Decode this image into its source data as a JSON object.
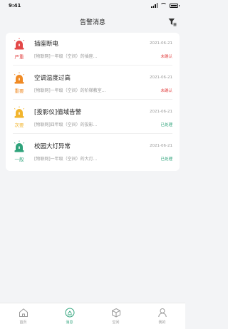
{
  "status_bar": {
    "time": "9:41"
  },
  "header": {
    "title": "告警消息"
  },
  "alarms": [
    {
      "level": "严重",
      "level_color": "#e34848",
      "title": "插座断电",
      "date": "2021-06-21",
      "desc": "[物联网]一年级（空间）的插座...",
      "status": "未确认",
      "status_color": "#e34848"
    },
    {
      "level": "重要",
      "level_color": "#f08a24",
      "title": "空调温度过高",
      "date": "2021-06-21",
      "desc": "[物联网]一年级（空间）的阶梯教室...",
      "status": "未确认",
      "status_color": "#e34848"
    },
    {
      "level": "次要",
      "level_color": "#f2b52e",
      "title": "[投影仪]值域告警",
      "date": "2021-06-21",
      "desc": "[物联网]四年级（空间）的投影...",
      "status": "已处理",
      "status_color": "#2fa37b"
    },
    {
      "level": "一般",
      "level_color": "#2fa37b",
      "title": "校园大灯异常",
      "date": "2021-06-21",
      "desc": "[物联网]一年级（空间）的大灯...",
      "status": "已处理",
      "status_color": "#2fa37b"
    }
  ],
  "tabs": [
    {
      "label": "首页",
      "icon": "home-icon"
    },
    {
      "label": "消息",
      "icon": "message-icon"
    },
    {
      "label": "空间",
      "icon": "space-cube-icon"
    },
    {
      "label": "我的",
      "icon": "user-icon"
    }
  ],
  "colors": {
    "accent": "#2fa37b",
    "inactive": "#999999"
  }
}
